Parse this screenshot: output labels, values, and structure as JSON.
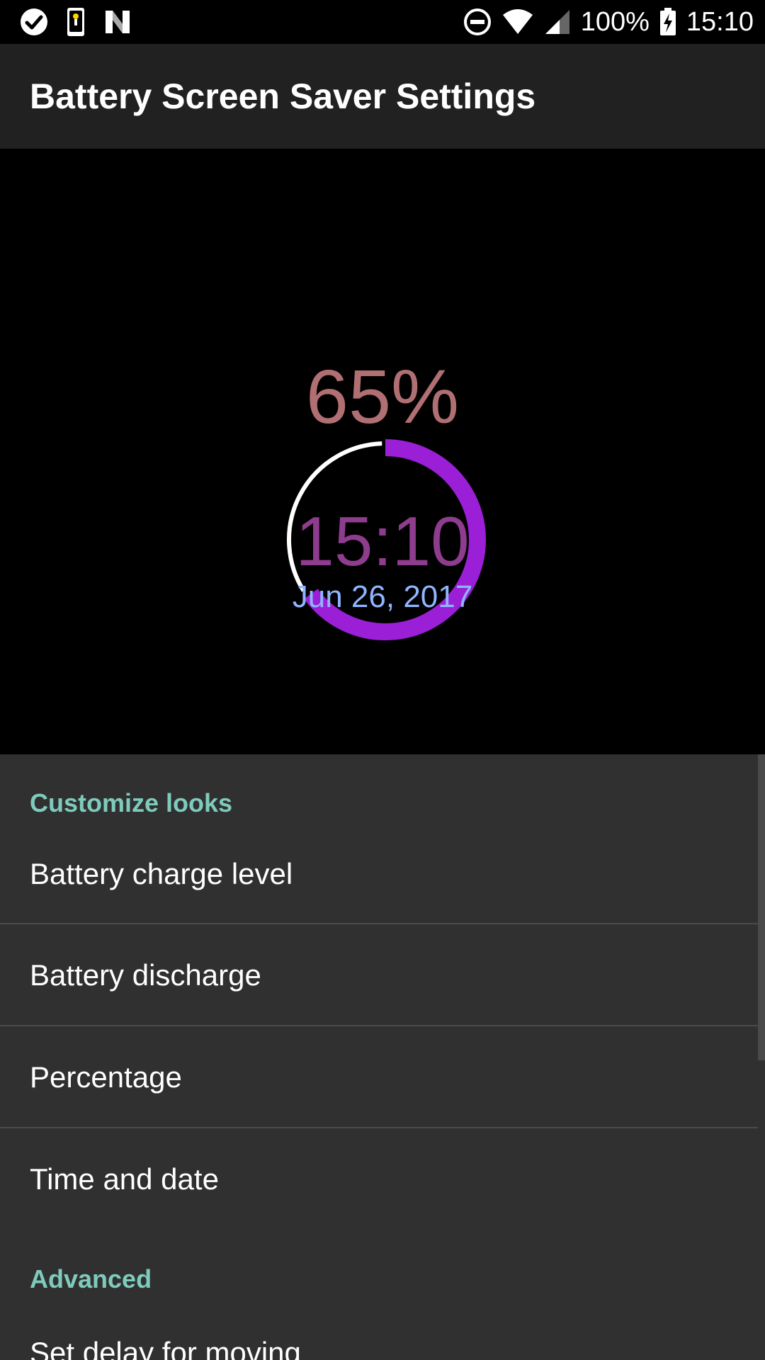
{
  "status_bar": {
    "battery_percent": "100%",
    "time": "15:10",
    "icons": [
      "check-circle-icon",
      "flashlight-icon",
      "n-logo-icon",
      "do-not-disturb-icon",
      "wifi-icon",
      "cell-signal-icon",
      "battery-charging-icon"
    ]
  },
  "app_bar": {
    "title": "Battery Screen Saver Settings"
  },
  "preview": {
    "percentage_text": "65%",
    "level": 0.65,
    "time": "15:10",
    "date": "Jun 26, 2017",
    "colors": {
      "arc_fill": "#9b1fd6",
      "arc_track": "#ffffff",
      "percent": "#b06f72",
      "clock": "#8e3d8e",
      "date": "#8fb5ff"
    }
  },
  "settings": {
    "sections": [
      {
        "header": "Customize looks",
        "items": [
          "Battery charge level",
          "Battery discharge",
          "Percentage",
          "Time and date"
        ]
      },
      {
        "header": "Advanced",
        "items": [
          "Set delay for moving"
        ]
      }
    ],
    "accent_color": "#7ecbbd"
  }
}
